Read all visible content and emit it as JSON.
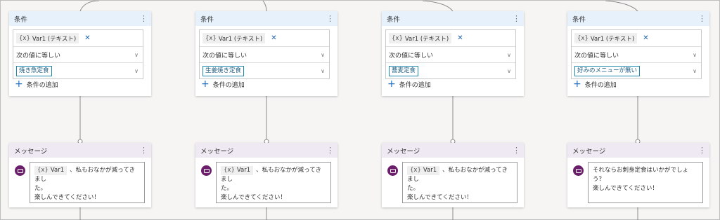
{
  "branches": [
    {
      "condition": {
        "title": "条件",
        "variable_glyph": "{x}",
        "variable": "Var1 (テキスト)",
        "remove_glyph": "✕",
        "operator": "次の値に等しい",
        "value": "焼き魚定食",
        "add_label": "条件の追加"
      },
      "message": {
        "title": "メッセージ",
        "line1_chip_glyph": "{x}",
        "line1_chip": "Var1",
        "line1_text": "、私もおなかが減ってきまし",
        "line2": "た。",
        "line3": "楽しんできてください！"
      }
    },
    {
      "condition": {
        "title": "条件",
        "variable_glyph": "{x}",
        "variable": "Var1 (テキスト)",
        "remove_glyph": "✕",
        "operator": "次の値に等しい",
        "value": "生姜焼き定食",
        "add_label": "条件の追加"
      },
      "message": {
        "title": "メッセージ",
        "line1_chip_glyph": "{x}",
        "line1_chip": "Var1",
        "line1_text": "、私もおなかが減ってきまし",
        "line2": "た。",
        "line3": "楽しんできてください！"
      }
    },
    {
      "condition": {
        "title": "条件",
        "variable_glyph": "{x}",
        "variable": "Var1 (テキスト)",
        "remove_glyph": "✕",
        "operator": "次の値に等しい",
        "value": "蕎麦定食",
        "add_label": "条件の追加"
      },
      "message": {
        "title": "メッセージ",
        "line1_chip_glyph": "{x}",
        "line1_chip": "Var1",
        "line1_text": "、私もおなかが減ってきまし",
        "line2": "た。",
        "line3": "楽しんできてください！"
      }
    },
    {
      "condition": {
        "title": "条件",
        "variable_glyph": "{x}",
        "variable": "Var1 (テキスト)",
        "remove_glyph": "✕",
        "operator": "次の値に等しい",
        "value": "好みのメニューが無い",
        "add_label": "条件の追加"
      },
      "message": {
        "title": "メッセージ",
        "line1_text": "それならお刺身定食はいかがでしょ",
        "line2": "う？",
        "line3": "楽しんできてください！"
      }
    }
  ],
  "icons": {
    "kebab": "⋮",
    "chevron": "∨",
    "plus": "+"
  },
  "colors": {
    "condition_header": "#e7f1fc",
    "message_header": "#efe9f3",
    "accent_blue": "#1b6ec2",
    "value_border": "#1f89ad",
    "message_icon": "#6b1f6b"
  }
}
